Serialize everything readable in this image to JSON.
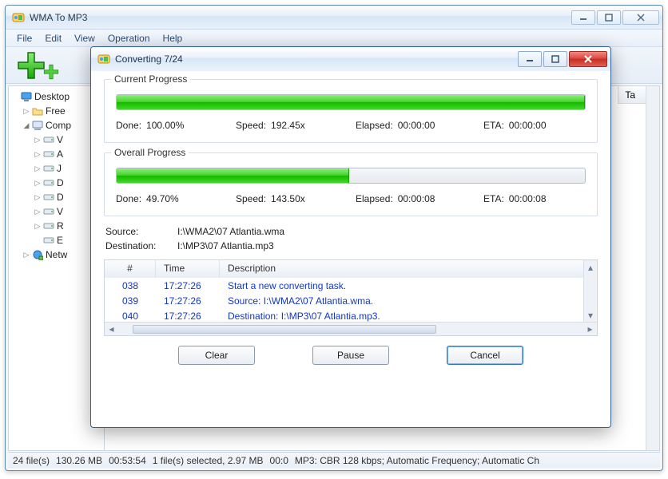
{
  "main": {
    "title": "WMA To MP3",
    "menu": [
      "File",
      "Edit",
      "View",
      "Operation",
      "Help"
    ],
    "tree": [
      {
        "icon": "monitor",
        "label": "Desktop",
        "twisty": "",
        "indent": 0
      },
      {
        "icon": "folder",
        "label": "Free",
        "twisty": "▷",
        "indent": 1
      },
      {
        "icon": "computer",
        "label": "Comp",
        "twisty": "◢",
        "indent": 1
      },
      {
        "icon": "drive",
        "label": "V",
        "twisty": "▷",
        "indent": 2
      },
      {
        "icon": "drive",
        "label": "A",
        "twisty": "▷",
        "indent": 2
      },
      {
        "icon": "drive",
        "label": "J",
        "twisty": "▷",
        "indent": 2
      },
      {
        "icon": "drive",
        "label": "D",
        "twisty": "▷",
        "indent": 2
      },
      {
        "icon": "drive",
        "label": "D",
        "twisty": "▷",
        "indent": 2
      },
      {
        "icon": "drive",
        "label": "V",
        "twisty": "▷",
        "indent": 2
      },
      {
        "icon": "drive",
        "label": "R",
        "twisty": "▷",
        "indent": 2
      },
      {
        "icon": "drive",
        "label": "E",
        "twisty": "",
        "indent": 2
      },
      {
        "icon": "network",
        "label": "Netw",
        "twisty": "▷",
        "indent": 1
      }
    ],
    "list_header_tail": "Ta",
    "statusbar": {
      "files": "24 file(s)",
      "size": "130.26 MB",
      "duration": "00:53:54",
      "selected": "1 file(s) selected, 2.97 MB",
      "seltime": "00:0",
      "format": "MP3:  CBR 128 kbps; Automatic Frequency; Automatic Ch"
    }
  },
  "dialog": {
    "title": "Converting 7/24",
    "current": {
      "legend": "Current Progress",
      "percent": 100.0,
      "done_label": "Done:",
      "done": "100.00%",
      "speed_label": "Speed:",
      "speed": "192.45x",
      "elapsed_label": "Elapsed:",
      "elapsed": "00:00:00",
      "eta_label": "ETA:",
      "eta": "00:00:00"
    },
    "overall": {
      "legend": "Overall Progress",
      "percent": 49.7,
      "done_label": "Done:",
      "done": "49.70%",
      "speed_label": "Speed:",
      "speed": "143.50x",
      "elapsed_label": "Elapsed:",
      "elapsed": "00:00:08",
      "eta_label": "ETA:",
      "eta": "00:00:08"
    },
    "source_label": "Source:",
    "source": "I:\\WMA2\\07 Atlantia.wma",
    "dest_label": "Destination:",
    "dest": "I:\\MP3\\07 Atlantia.mp3",
    "log": {
      "headers": {
        "num": "#",
        "time": "Time",
        "desc": "Description"
      },
      "rows": [
        {
          "num": "038",
          "time": "17:27:26",
          "desc": "Start a new converting task."
        },
        {
          "num": "039",
          "time": "17:27:26",
          "desc": "Source:  I:\\WMA2\\07 Atlantia.wma."
        },
        {
          "num": "040",
          "time": "17:27:26",
          "desc": "Destination: I:\\MP3\\07 Atlantia.mp3."
        }
      ]
    },
    "buttons": {
      "clear": "Clear",
      "pause": "Pause",
      "cancel": "Cancel"
    }
  }
}
